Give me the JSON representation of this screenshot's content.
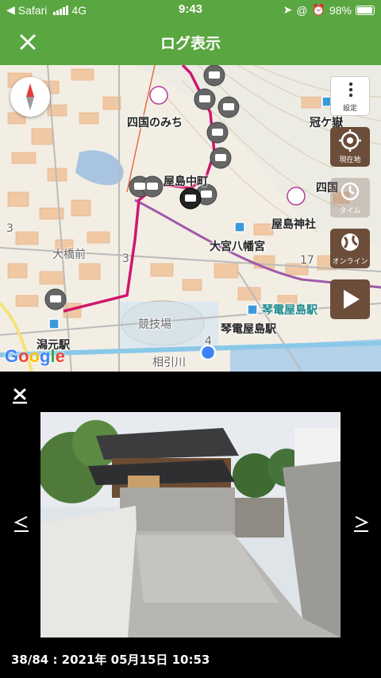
{
  "status_bar": {
    "back_app": "Safari",
    "network": "4G",
    "time": "9:43",
    "battery": "98%"
  },
  "header": {
    "title": "ログ表示"
  },
  "map": {
    "labels": {
      "shikoku_no_michi": "四国のみち",
      "kanmuri_ga_take": "冠ケ嶽",
      "yashima_nakamachi": "屋島中町",
      "shikoku": "四国",
      "yashima_jinja": "屋島神社",
      "omiya_hachimangu": "大宮八幡宮",
      "ohashimae": "大橋前",
      "kotoden_yashima_station_right": "琴電屋島駅",
      "kotoden_yashima_station": "琴電屋島駅",
      "kyogijo": "競技場",
      "katamoto_station": "潟元駅",
      "aibikigawa": "相引川",
      "route_3a": "3",
      "route_3b": "3",
      "route_17": "17",
      "route_4": "4"
    },
    "buttons": {
      "settings": "設定",
      "current_location": "現在地",
      "time": "タイム",
      "online": "オンライン"
    },
    "google_logo": "Google"
  },
  "photo_panel": {
    "caption": "38/84 : 2021年 05月15日 10:53",
    "prev": "<",
    "next": ">"
  },
  "colors": {
    "header_green": "#5aa640",
    "track_magenta": "#d0176f",
    "button_brown": "#6b4d3a",
    "location_blue": "#3b82f6"
  }
}
